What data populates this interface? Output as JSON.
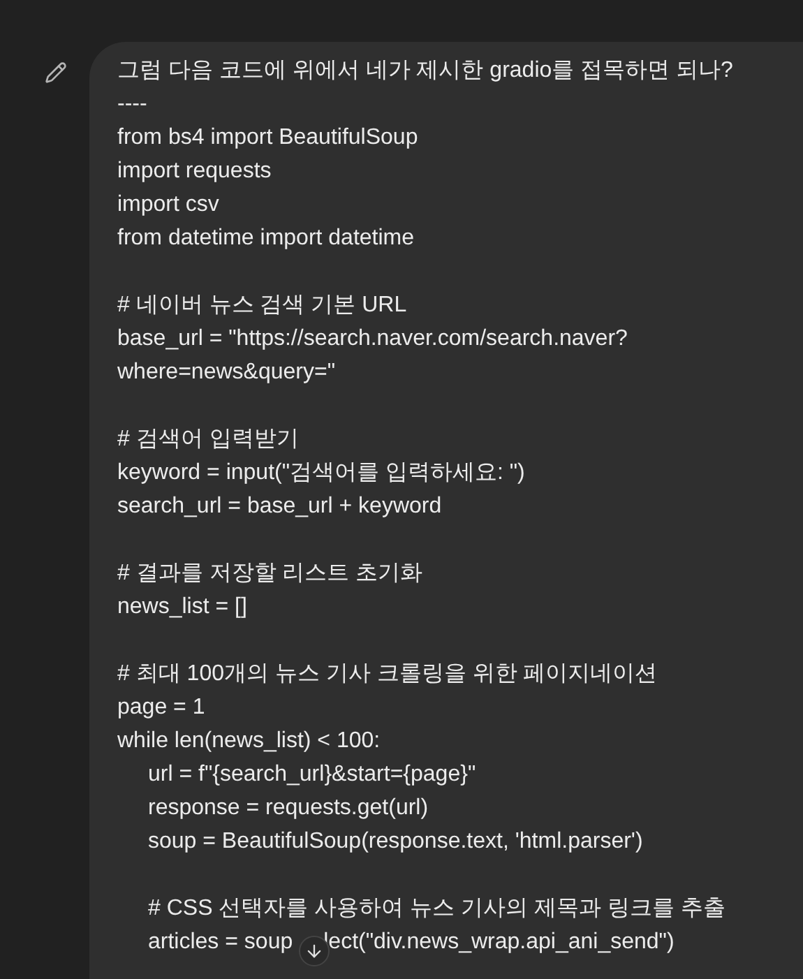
{
  "message": {
    "blocks": [
      {
        "lines": [
          {
            "text": "그럼 다음 코드에 위에서 네가 제시한 gradio를 접목하면 되나?"
          },
          {
            "text": "----"
          },
          {
            "text": "from bs4 import BeautifulSoup"
          },
          {
            "text": "import requests"
          },
          {
            "text": "import csv"
          },
          {
            "text": "from datetime import datetime"
          }
        ]
      },
      {
        "lines": [
          {
            "text": "# 네이버 뉴스 검색 기본 URL"
          },
          {
            "text": "base_url = \"https://search.naver.com/search.naver?"
          },
          {
            "text": "where=news&query=\""
          }
        ]
      },
      {
        "lines": [
          {
            "text": "# 검색어 입력받기"
          },
          {
            "text": "keyword = input(\"검색어를 입력하세요: \")"
          },
          {
            "text": "search_url = base_url + keyword"
          }
        ]
      },
      {
        "lines": [
          {
            "text": "# 결과를 저장할 리스트 초기화"
          },
          {
            "text": "news_list = []"
          }
        ]
      },
      {
        "lines": [
          {
            "text": "# 최대 100개의 뉴스 기사 크롤링을 위한 페이지네이션"
          },
          {
            "text": "page = 1"
          },
          {
            "text": "while len(news_list) < 100:",
            "children": [
              {
                "lines": [
                  {
                    "text": "url = f\"{search_url}&start={page}\""
                  },
                  {
                    "text": "response = requests.get(url)"
                  },
                  {
                    "text": "soup = BeautifulSoup(response.text, 'html.parser')"
                  }
                ]
              },
              {
                "lines": [
                  {
                    "text": "# CSS 선택자를 사용하여 뉴스 기사의 제목과 링크를 추출"
                  },
                  {
                    "parts": [
                      "articles = soup",
                      "lect(\"div.news_wrap.api_ani_send\")"
                    ]
                  }
                ]
              }
            ]
          }
        ]
      }
    ]
  }
}
